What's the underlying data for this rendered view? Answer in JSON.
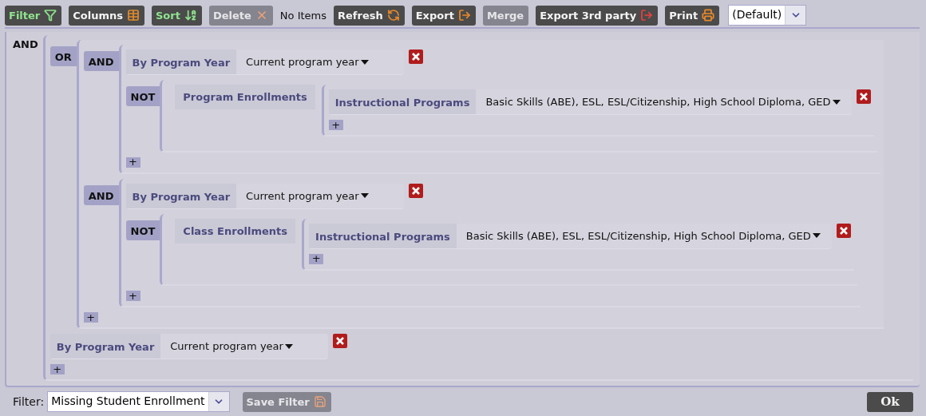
{
  "toolbar": {
    "buttons": [
      {
        "label": "Filter",
        "kind": "filter",
        "active": true,
        "disabled": false
      },
      {
        "label": "Columns",
        "kind": "columns",
        "active": false,
        "disabled": false
      },
      {
        "label": "Sort",
        "kind": "sort",
        "active": true,
        "disabled": false
      },
      {
        "label": "Delete",
        "kind": "delete",
        "active": false,
        "disabled": true
      }
    ],
    "status": "No Items",
    "buttons_2": [
      {
        "label": "Refresh",
        "kind": "refresh",
        "active": false,
        "disabled": false
      },
      {
        "label": "Export",
        "kind": "export",
        "active": false,
        "disabled": false
      },
      {
        "label": "Merge",
        "kind": "merge",
        "active": false,
        "disabled": true
      },
      {
        "label": "Export 3rd party",
        "kind": "export_third_party",
        "active": false,
        "disabled": false
      },
      {
        "label": "Print",
        "kind": "print",
        "active": false,
        "disabled": false
      }
    ],
    "layout_select": {
      "value": "(Default)"
    }
  },
  "filter_tree": {
    "kind": "group",
    "operator": "AND",
    "add": "+",
    "children": [
      {
        "kind": "group",
        "operator": "OR",
        "add": "+",
        "children": [
          {
            "kind": "group",
            "operator": "AND",
            "add": "+",
            "children": [
              {
                "kind": "condition",
                "field": "By Program Year",
                "value": "Current program year"
              },
              {
                "kind": "group",
                "operator": "NOT",
                "children": [
                  {
                    "kind": "relation",
                    "label": "Program Enrollments",
                    "add": "+",
                    "children": [
                      {
                        "kind": "condition",
                        "field": "Instructional Programs",
                        "value": "Basic Skills (ABE), ESL, ESL/Citizenship, High School Diploma, GED"
                      }
                    ]
                  }
                ]
              }
            ]
          },
          {
            "kind": "group",
            "operator": "AND",
            "add": "+",
            "children": [
              {
                "kind": "condition",
                "field": "By Program Year",
                "value": "Current program year"
              },
              {
                "kind": "group",
                "operator": "NOT",
                "children": [
                  {
                    "kind": "relation",
                    "label": "Class Enrollments",
                    "add": "+",
                    "children": [
                      {
                        "kind": "condition",
                        "field": "Instructional Programs",
                        "value": "Basic Skills (ABE), ESL, ESL/Citizenship, High School Diploma, GED"
                      }
                    ]
                  }
                ]
              }
            ]
          }
        ]
      },
      {
        "kind": "condition",
        "field": "By Program Year",
        "value": "Current program year"
      }
    ]
  },
  "footer": {
    "filter_label": "Filter:",
    "filter_value": "Missing Student Enrollment",
    "save_button": {
      "label": "Save Filter",
      "disabled": true
    },
    "ok_button": {
      "label": "Ok",
      "disabled": false
    }
  }
}
